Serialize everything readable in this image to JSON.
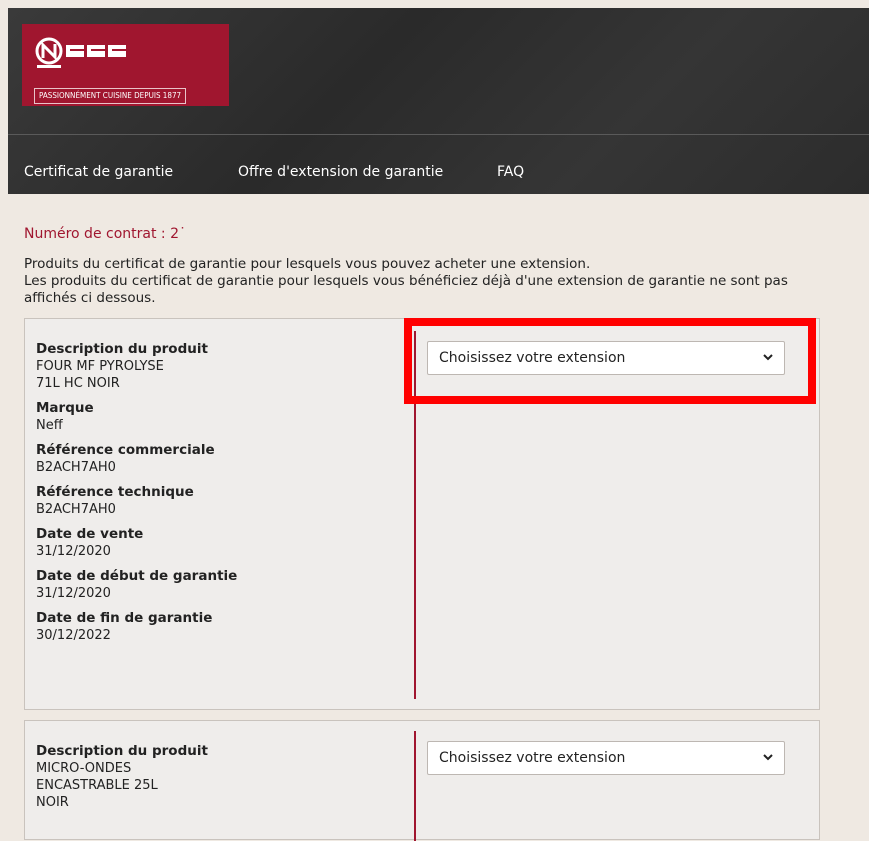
{
  "brand": {
    "name": "NEFF",
    "tagline": "PASSIONNÉMENT CUISINE DEPUIS 1877",
    "color": "#a0162f"
  },
  "nav": {
    "items": [
      "Certificat de garantie",
      "Offre d'extension de garantie",
      "FAQ"
    ]
  },
  "contract": {
    "label": "Numéro de contrat :",
    "value": "2˙"
  },
  "intro": {
    "line1": "Produits du certificat de garantie pour lesquels vous pouvez acheter une extension.",
    "line2": "Les produits du certificat de garantie pour lesquels vous bénéficiez déjà d'une extension de garantie ne sont pas affichés ci dessous."
  },
  "products": [
    {
      "description_label": "Description du produit",
      "description": "FOUR MF PYROLYSE\n71L HC NOIR",
      "brand_label": "Marque",
      "brand": "Neff",
      "commercial_ref_label": "Référence commerciale",
      "commercial_ref": "B2ACH7AH0",
      "technical_ref_label": "Référence technique",
      "technical_ref": "B2ACH7AH0",
      "sale_date_label": "Date de vente",
      "sale_date": "31/12/2020",
      "warranty_start_label": "Date de début de garantie",
      "warranty_start": "31/12/2020",
      "warranty_end_label": "Date de fin de garantie",
      "warranty_end": "30/12/2022",
      "extension_select": "Choisissez votre extension"
    },
    {
      "description_label": "Description du produit",
      "description": "MICRO-ONDES\nENCASTRABLE 25L\nNOIR",
      "extension_select": "Choisissez votre extension"
    }
  ],
  "highlight_color": "#ff0000"
}
